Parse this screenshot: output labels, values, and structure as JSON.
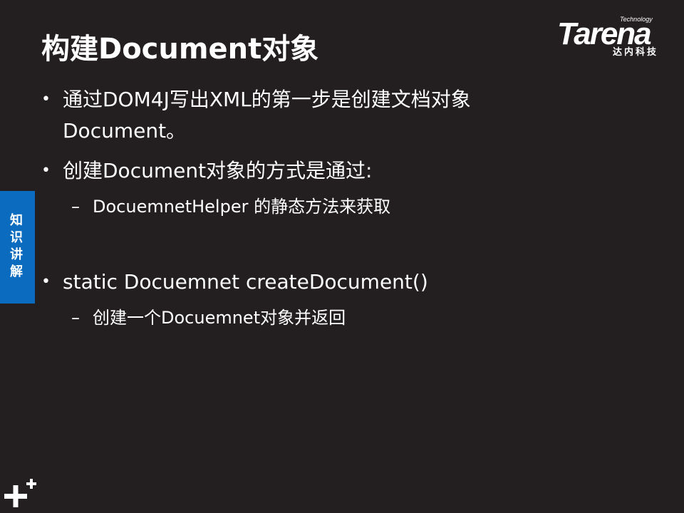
{
  "slide": {
    "title": "构建Document对象",
    "logo": {
      "tech": "Technology",
      "word": "Tarena",
      "cn": "达内科技"
    },
    "side_tab": [
      "知",
      "识",
      "讲",
      "解"
    ],
    "bullets": [
      {
        "line1": "通过DOM4J写出XML的第一步是创建文档对象",
        "line2": "Document。"
      },
      {
        "line1": "创建Document对象的方式是通过:"
      },
      {
        "sub": "DocuemnetHelper 的静态方法来获取"
      },
      {
        "line1": "static Docuemnet createDocument()"
      },
      {
        "sub": "创建一个Docuemnet对象并返回"
      }
    ],
    "bullet_symbol": "•",
    "dash_symbol": "–"
  },
  "colors": {
    "background": "#231f20",
    "side_tab": "#0a6bbf",
    "text": "#ffffff"
  }
}
